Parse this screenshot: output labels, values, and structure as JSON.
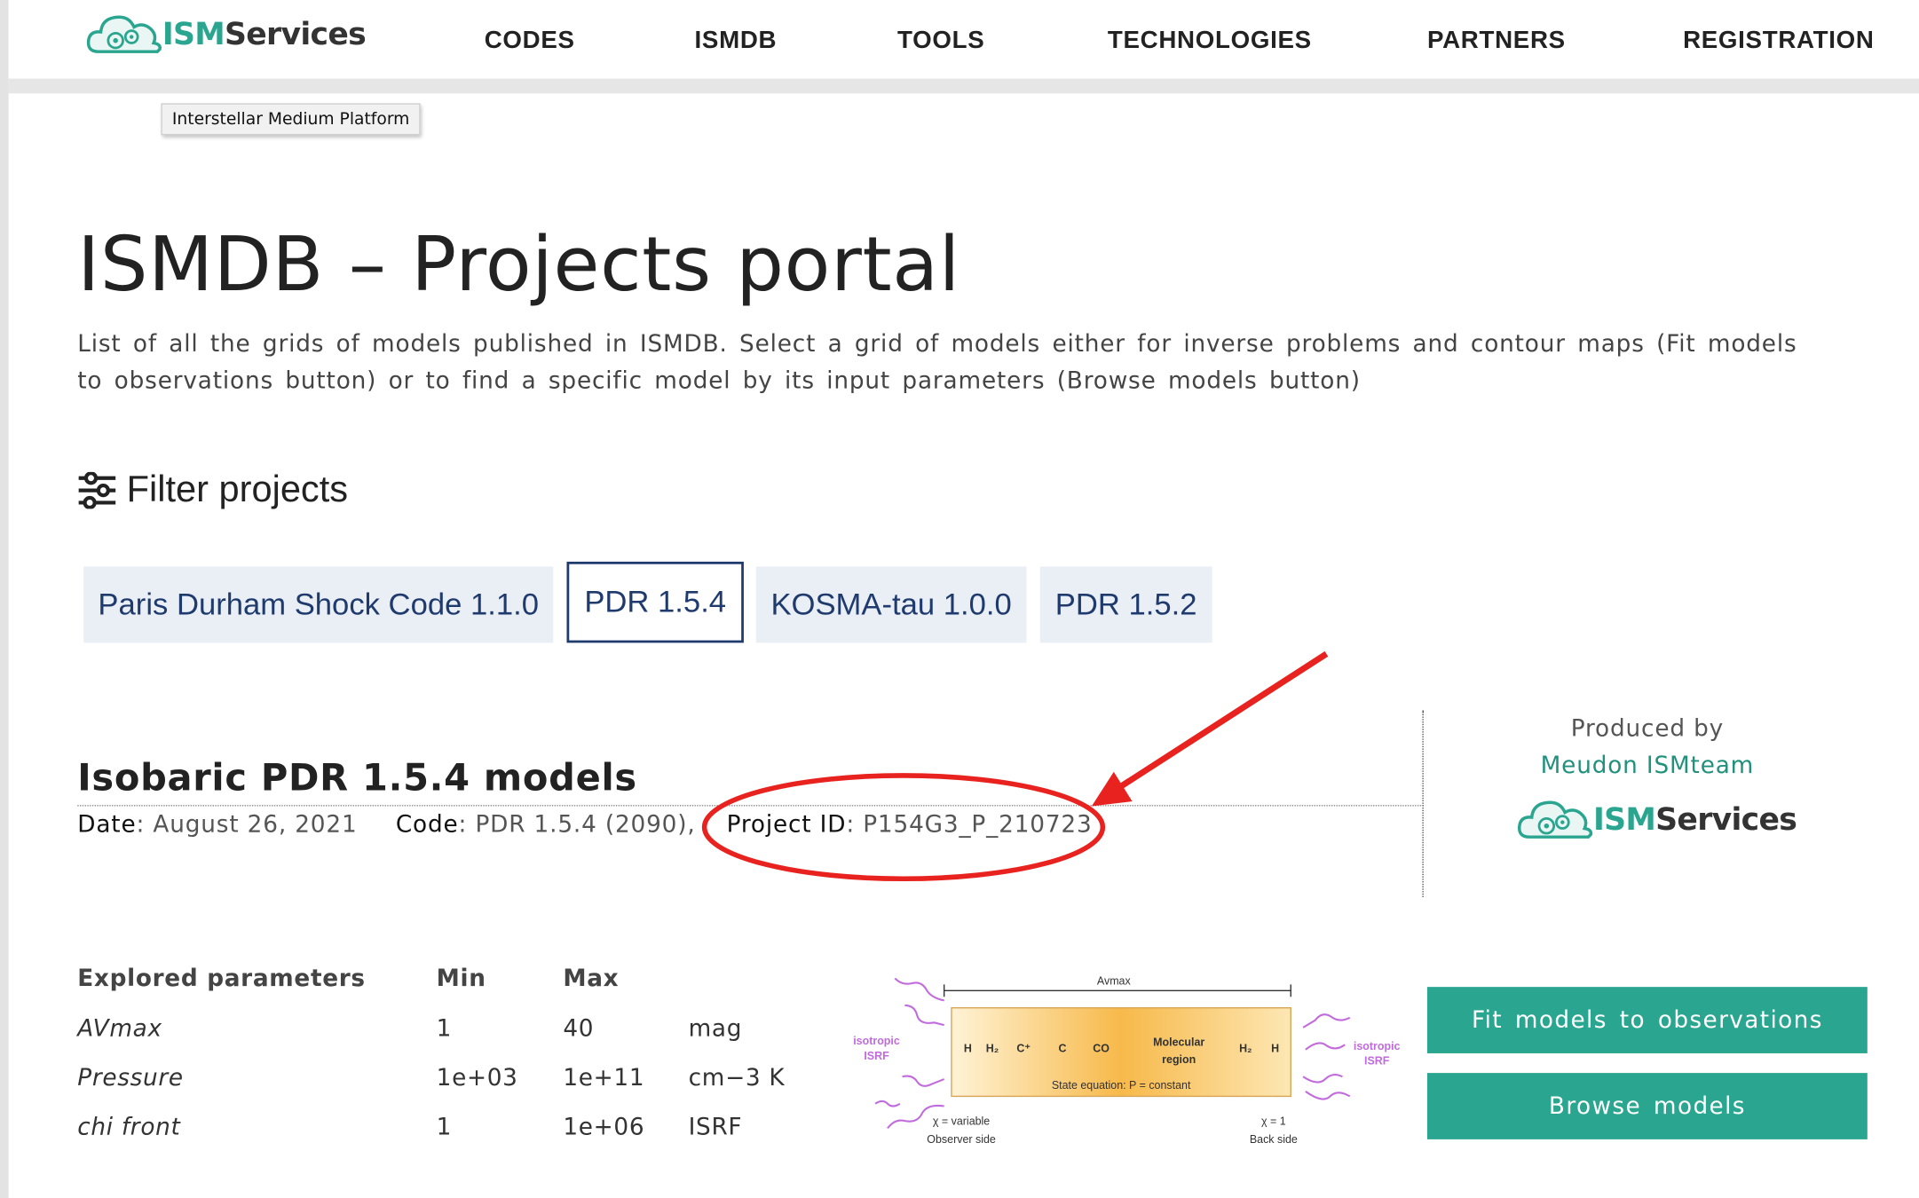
{
  "brand": {
    "name_part1": "ISM",
    "name_part2": "Services",
    "tooltip": "Interstellar Medium Platform"
  },
  "nav": {
    "items": [
      "CODES",
      "ISMDB",
      "TOOLS",
      "TECHNOLOGIES",
      "PARTNERS",
      "REGISTRATION"
    ]
  },
  "page": {
    "title": "ISMDB – Projects portal",
    "description": "List of all the grids of models published in ISMDB. Select a grid of models either for inverse problems and contour maps (Fit models to observations button) or to find a specific model by its input parameters (Browse models button)"
  },
  "filter": {
    "heading": "Filter projects",
    "options": [
      {
        "label": "Paris Durham Shock Code 1.1.0",
        "active": false
      },
      {
        "label": "PDR 1.5.4",
        "active": true
      },
      {
        "label": "KOSMA-tau 1.0.0",
        "active": false
      },
      {
        "label": "PDR 1.5.2",
        "active": false
      }
    ]
  },
  "project": {
    "title": "Isobaric PDR 1.5.4 models",
    "date_label": "Date",
    "date": "August 26, 2021",
    "code_label": "Code",
    "code": "PDR 1.5.4 (2090),",
    "id_label": "Project ID",
    "id": "P154G3_P_210723",
    "produced_by": "Produced by",
    "team": "Meudon ISMteam",
    "params_header": {
      "name": "Explored parameters",
      "min": "Min",
      "max": "Max"
    },
    "params": [
      {
        "name": "AVmax",
        "min": "1",
        "max": "40",
        "unit": "mag"
      },
      {
        "name": "Pressure",
        "min": "1e+03",
        "max": "1e+11",
        "unit": "cm−3 K"
      },
      {
        "name": "chi front",
        "min": "1",
        "max": "1e+06",
        "unit": "ISRF"
      }
    ],
    "fit_button": "Fit models to observations",
    "browse_button": "Browse models"
  },
  "diagram": {
    "avmax": "Avmax",
    "isrf_left": [
      "isotropic",
      "ISRF"
    ],
    "isrf_right": [
      "isotropic",
      "ISRF"
    ],
    "species": [
      "H",
      "H₂",
      "C⁺",
      "C",
      "CO"
    ],
    "species_right": [
      "H₂",
      "H"
    ],
    "molecular": [
      "Molecular",
      "region"
    ],
    "state_eq": "State equation: P = constant",
    "chi_left": "χ = variable",
    "side_left": "Observer side",
    "chi_right": "χ = 1",
    "side_right": "Back side"
  },
  "colors": {
    "accent": "#2aa58f",
    "navy": "#1f3b6e",
    "annotation": "#e8231f"
  }
}
